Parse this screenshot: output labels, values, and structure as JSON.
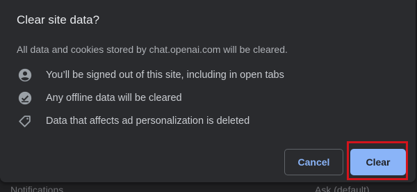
{
  "dialog": {
    "title": "Clear site data?",
    "description": "All data and cookies stored by chat.openai.com will be cleared.",
    "items": [
      {
        "icon": "account-circle-icon",
        "label": "You’ll be signed out of this site, including in open tabs"
      },
      {
        "icon": "offline-check-icon",
        "label": "Any offline data will be cleared"
      },
      {
        "icon": "tag-icon",
        "label": "Data that affects ad personalization is deleted"
      }
    ],
    "cancel_label": "Cancel",
    "clear_label": "Clear"
  },
  "background": {
    "left_text": "Notifications",
    "right_text": "Ask (default)"
  },
  "colors": {
    "dialog_bg": "#2a2b2e",
    "accent": "#8ab4f8",
    "highlight": "#d4141c"
  }
}
